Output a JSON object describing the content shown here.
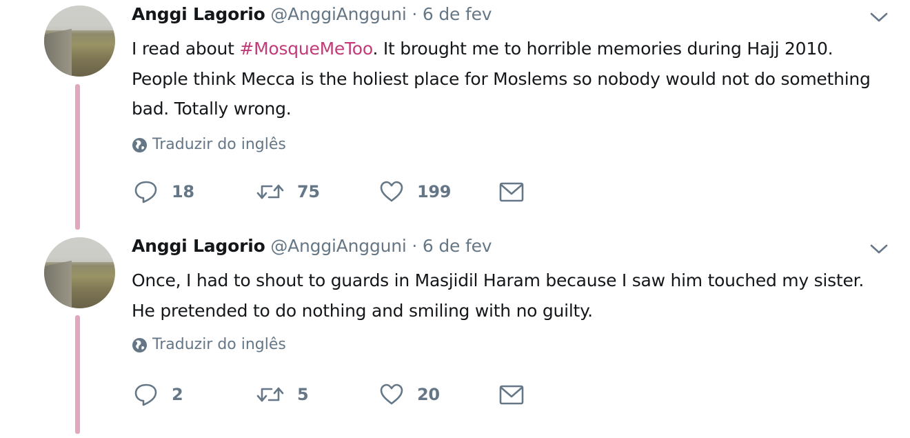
{
  "tweets": [
    {
      "author_name": "Anggi Lagorio",
      "handle": "@AnggiAngguni",
      "separator": "·",
      "date": "6 de fev",
      "text_before": "I read about ",
      "hashtag": "#MosqueMeToo",
      "text_after": ". It brought me to horrible memories during Hajj 2010. People think Mecca is the holiest place for Moslems so nobody would not do something bad. Totally wrong.",
      "translate_label": "Traduzir do inglês",
      "replies": "18",
      "retweets": "75",
      "likes": "199"
    },
    {
      "author_name": "Anggi Lagorio",
      "handle": "@AnggiAngguni",
      "separator": "·",
      "date": "6 de fev",
      "text": "Once, I had to shout to guards in Masjidil Haram because I saw him touched my sister. He pretended to do nothing and smiling with no guilty.",
      "translate_label": "Traduzir do inglês",
      "replies": "2",
      "retweets": "5",
      "likes": "20"
    }
  ],
  "icons": {
    "reply": "reply-icon",
    "retweet": "retweet-icon",
    "like": "heart-icon",
    "dm": "envelope-icon",
    "more": "chevron-down-icon",
    "translate": "globe-icon"
  },
  "colors": {
    "thread_line": "#e2a6be",
    "hashtag": "#c13b78",
    "secondary_text": "#657786",
    "primary_text": "#14171a"
  }
}
